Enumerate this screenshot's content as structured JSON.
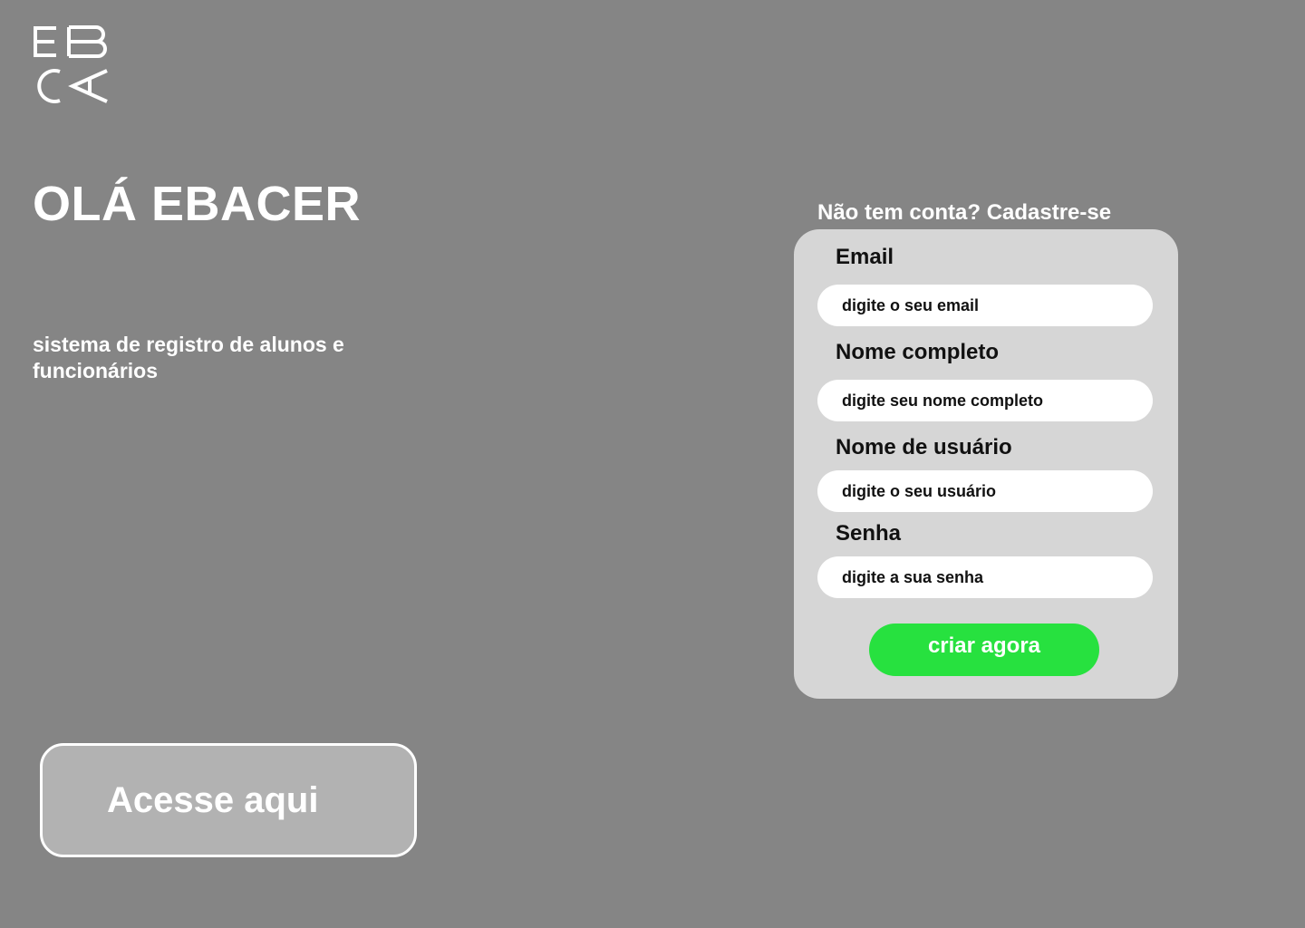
{
  "brand": {
    "logo_icon": "ebac-logo-icon"
  },
  "hero": {
    "title": "OLÁ EBACER",
    "subtitle": "sistema de registro de alunos e funcionários"
  },
  "access": {
    "button_label": "Acesse aqui"
  },
  "signup": {
    "prompt": "Não tem conta? Cadastre-se",
    "fields": {
      "email": {
        "label": "Email",
        "placeholder": "digite o seu email"
      },
      "full_name": {
        "label": "Nome completo",
        "placeholder": "digite seu nome completo"
      },
      "username": {
        "label": "Nome de usuário",
        "placeholder": "digite o seu usuário"
      },
      "password": {
        "label": "Senha",
        "placeholder": "digite a sua senha"
      }
    },
    "submit_label": "criar agora"
  },
  "colors": {
    "background": "#858585",
    "card": "#d6d6d6",
    "accent": "#27e13f",
    "access_button": "#b2b2b2"
  }
}
